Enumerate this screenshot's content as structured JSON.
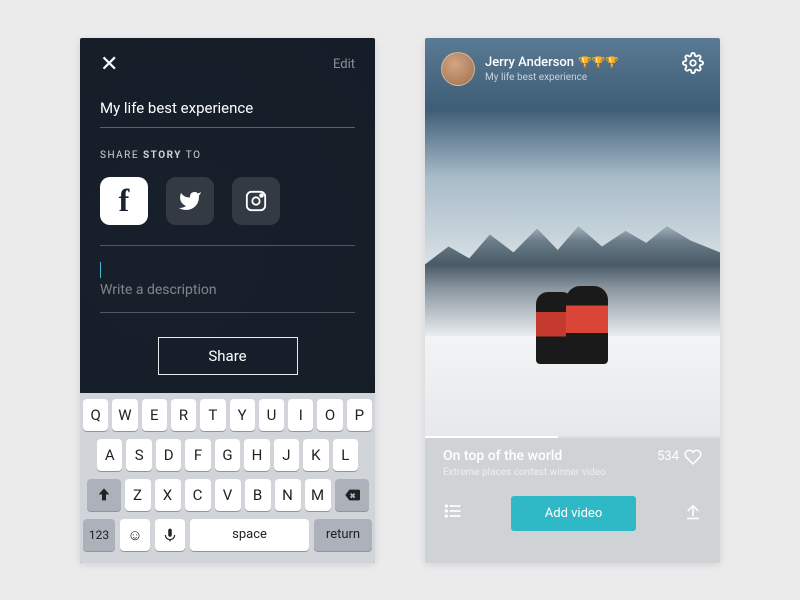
{
  "left": {
    "edit": "Edit",
    "title": "My life best experience",
    "shareLabel": "SHARE",
    "shareLabelBold": "STORY",
    "shareLabelEnd": "TO",
    "descPlaceholder": "Write a description",
    "shareBtn": "Share",
    "keyboard": {
      "row1": [
        "Q",
        "W",
        "E",
        "R",
        "T",
        "Y",
        "U",
        "I",
        "O",
        "P"
      ],
      "row2": [
        "A",
        "S",
        "D",
        "F",
        "G",
        "H",
        "J",
        "K",
        "L"
      ],
      "row3": [
        "Z",
        "X",
        "C",
        "V",
        "B",
        "N",
        "M"
      ],
      "num": "123",
      "space": "space",
      "return": "return"
    }
  },
  "right": {
    "user": "Jerry Anderson",
    "trophies": "🏆🏆🏆",
    "userSub": "My life best experience",
    "videoTitle": "On top of the world",
    "videoSub": "Extreme places contest winner video",
    "likes": "534",
    "addBtn": "Add video"
  }
}
